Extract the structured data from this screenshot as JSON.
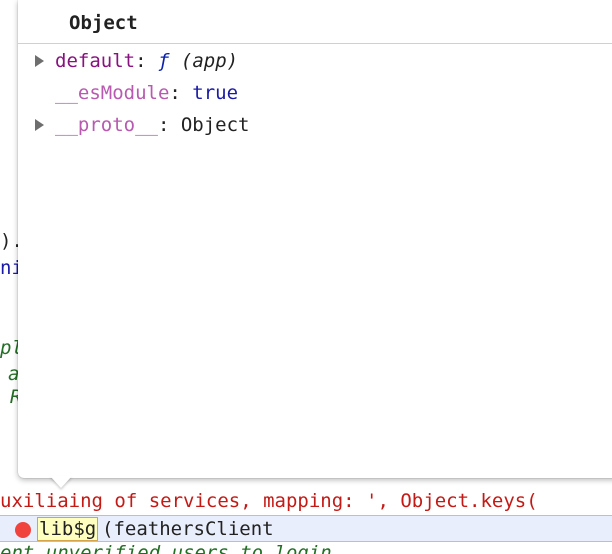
{
  "popover": {
    "title": "Object",
    "properties": [
      {
        "key": "default",
        "separator": ":",
        "func_symbol": "ƒ",
        "value": "(app)",
        "expandable": true
      },
      {
        "key": "__esModule",
        "separator": ":",
        "value": "true",
        "expandable": false
      },
      {
        "key": "__proto__",
        "separator": ":",
        "value": "Object",
        "expandable": true
      }
    ]
  },
  "editor": {
    "background_fragments": [
      {
        "text": ")."
      },
      {
        "text": "ni"
      },
      {
        "text": "pl"
      },
      {
        "text": "a"
      },
      {
        "text": "R"
      }
    ],
    "prev_line": {
      "part1": "uxilia",
      "part2": "ing of services, mapping: ', Object.keys("
    },
    "current_line": {
      "token": "lib$g",
      "rest": "(feathersClient"
    },
    "next_line": "ent unverified users to login"
  },
  "colors": {
    "breakpoint": "#f1433d",
    "current_line_bg": "#e8eefb",
    "token_highlight": "#ffffbf",
    "property_key": "#881280",
    "internal_key": "#b85ab0",
    "boolean": "#1a1aa6"
  }
}
